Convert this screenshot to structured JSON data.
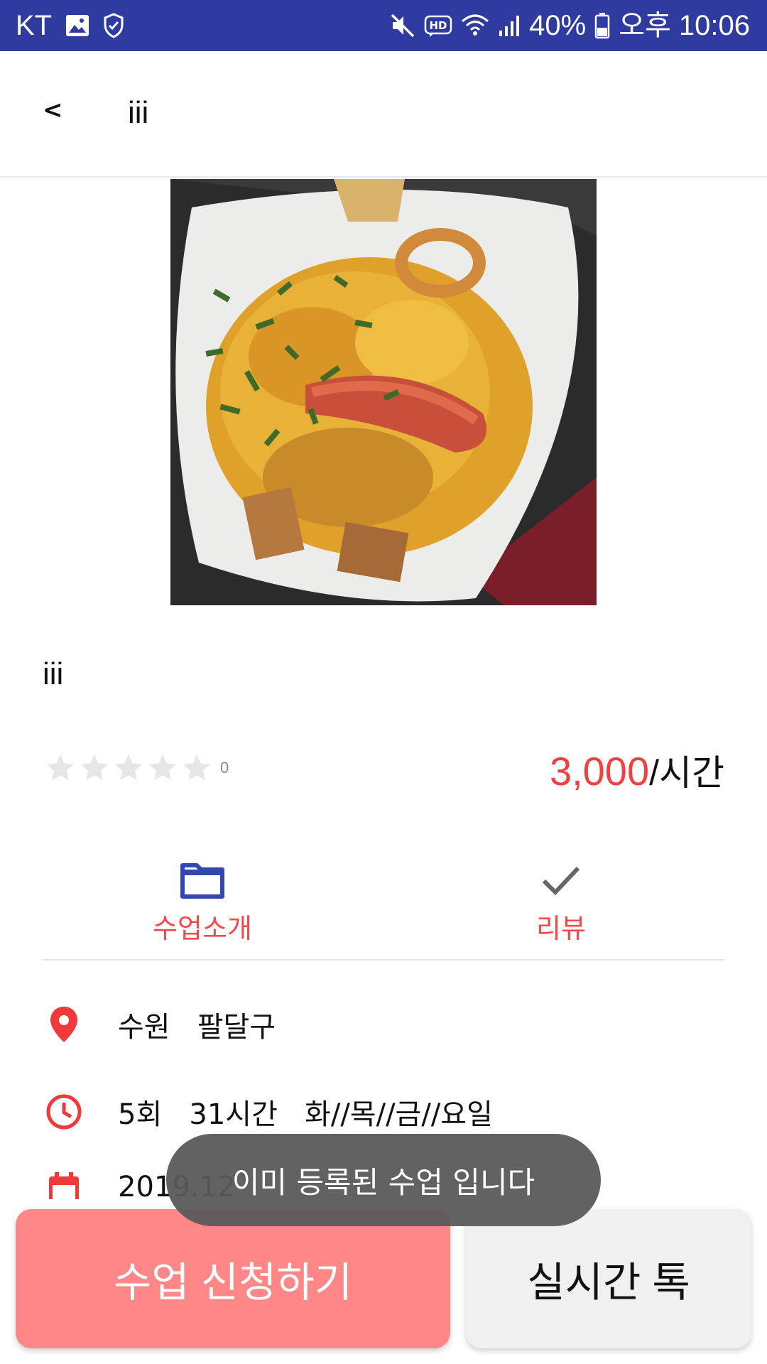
{
  "status_bar": {
    "carrier": "KT",
    "battery": "40%",
    "time": "오후 10:06",
    "icons": [
      "gallery-icon",
      "shield-icon",
      "mute-icon",
      "hd-icon",
      "wifi-icon",
      "signal-icon",
      "battery-icon"
    ]
  },
  "toolbar": {
    "back_label": "<",
    "title": "iii"
  },
  "hero_image": {
    "description_icon": "food-photo"
  },
  "class_info": {
    "title": "iii",
    "rating_count": "0",
    "rating_value": 0,
    "rating_max": 5,
    "price": "3,000",
    "price_unit": "/시간"
  },
  "tabs": [
    {
      "label": "수업소개",
      "icon": "folder-icon"
    },
    {
      "label": "리뷰",
      "icon": "check-icon"
    }
  ],
  "details": {
    "location": "수원   팔달구",
    "schedule": "5회   31시간   화//목//금//요일",
    "date": "2019.12"
  },
  "toast": {
    "message": "이미 등록된 수업 입니다"
  },
  "actions": {
    "apply_label": "수업 신청하기",
    "chat_label": "실시간 톡"
  },
  "colors": {
    "status_bar": "#2f3b9e",
    "accent_red": "#f04040",
    "apply_button": "#ff8787",
    "folder_icon": "#3347b0"
  }
}
